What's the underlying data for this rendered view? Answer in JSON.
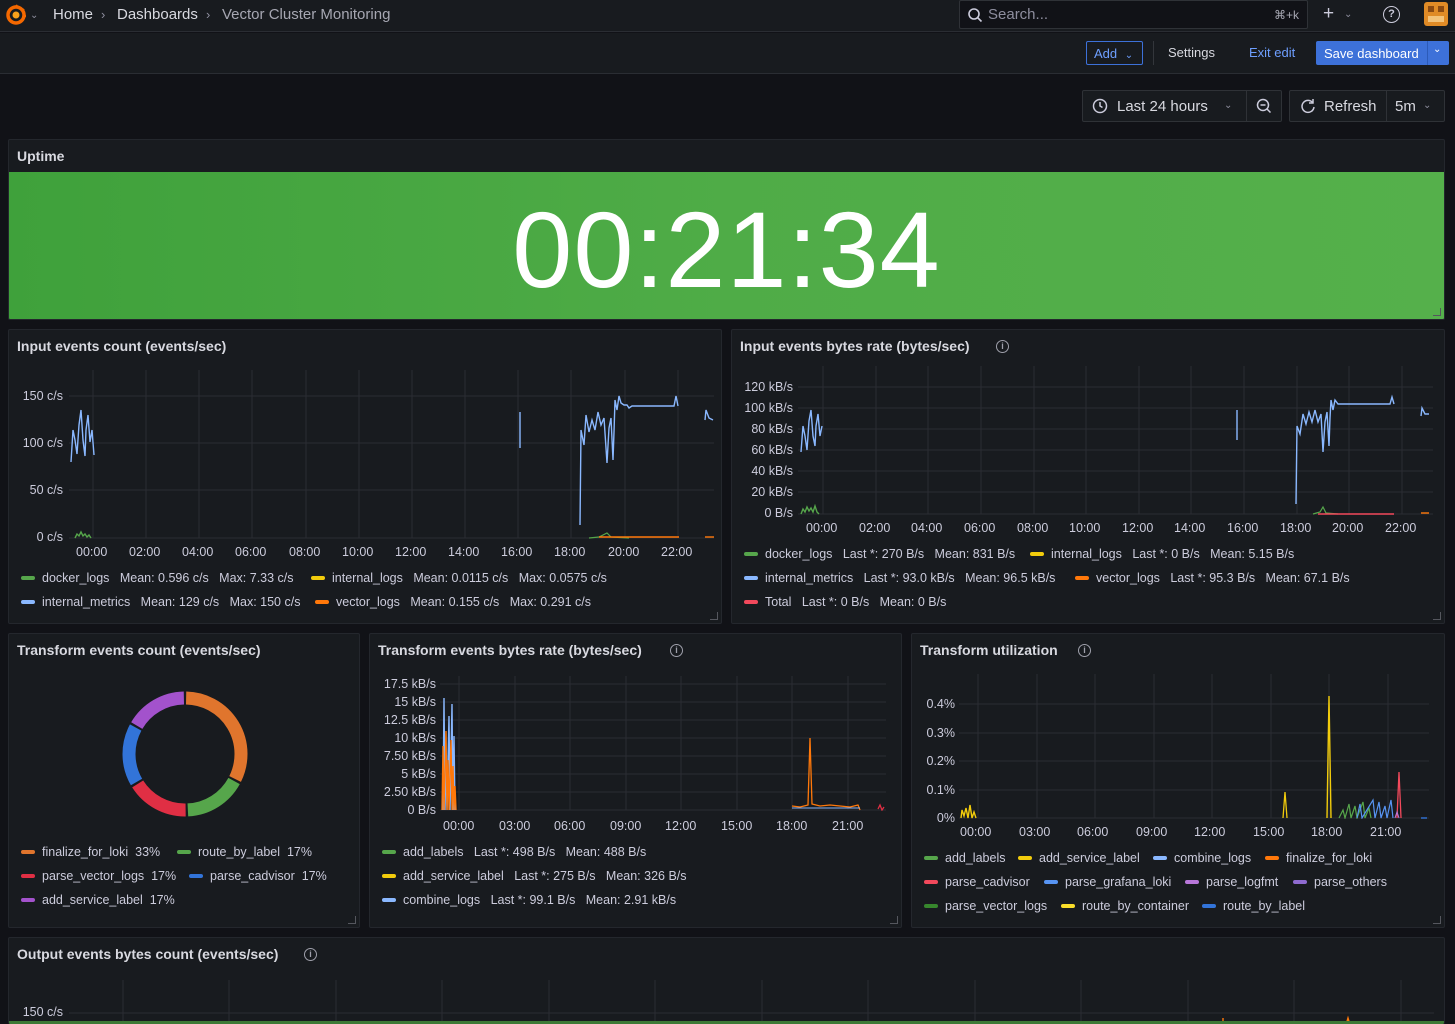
{
  "nav": {
    "breadcrumb": [
      "Home",
      "Dashboards",
      "Vector Cluster Monitoring"
    ],
    "search_placeholder": "Search...",
    "search_shortcut": "⌘+k"
  },
  "toolbar": {
    "add_label": "Add",
    "settings_label": "Settings",
    "exit_edit_label": "Exit edit",
    "save_label": "Save dashboard"
  },
  "time": {
    "range_label": "Last 24 hours",
    "refresh_label": "Refresh",
    "interval": "5m"
  },
  "uptime": {
    "title": "Uptime",
    "value": "00:21:34",
    "color": "#4fac47"
  },
  "input_count": {
    "title": "Input events count (events/sec)",
    "y_ticks": [
      "150 c/s",
      "100 c/s",
      "50 c/s",
      "0 c/s"
    ],
    "x_ticks": [
      "00:00",
      "02:00",
      "04:00",
      "06:00",
      "08:00",
      "10:00",
      "12:00",
      "14:00",
      "16:00",
      "18:00",
      "20:00",
      "22:00"
    ],
    "legend": [
      {
        "name": "docker_logs",
        "stats": "Mean: 0.596 c/s   Max: 7.33 c/s",
        "color": "#56a64b"
      },
      {
        "name": "internal_logs",
        "stats": "Mean: 0.0115 c/s   Max: 0.0575 c/s",
        "color": "#f2cc0c"
      },
      {
        "name": "internal_metrics",
        "stats": "Mean: 129 c/s   Max: 150 c/s",
        "color": "#8ab8ff"
      },
      {
        "name": "vector_logs",
        "stats": "Mean: 0.155 c/s   Max: 0.291 c/s",
        "color": "#ff780a"
      }
    ]
  },
  "input_bytes": {
    "title": "Input events bytes rate (bytes/sec)",
    "y_ticks": [
      "120 kB/s",
      "100 kB/s",
      "80 kB/s",
      "60 kB/s",
      "40 kB/s",
      "20 kB/s",
      "0 B/s"
    ],
    "x_ticks": [
      "00:00",
      "02:00",
      "04:00",
      "06:00",
      "08:00",
      "10:00",
      "12:00",
      "14:00",
      "16:00",
      "18:00",
      "20:00",
      "22:00"
    ],
    "legend": [
      {
        "name": "docker_logs",
        "stats": "Last *: 270 B/s   Mean: 831 B/s",
        "color": "#56a64b"
      },
      {
        "name": "internal_logs",
        "stats": "Last *: 0 B/s   Mean: 5.15 B/s",
        "color": "#f2cc0c"
      },
      {
        "name": "internal_metrics",
        "stats": "Last *: 93.0 kB/s   Mean: 96.5 kB/s",
        "color": "#8ab8ff"
      },
      {
        "name": "vector_logs",
        "stats": "Last *: 95.3 B/s   Mean: 67.1 B/s",
        "color": "#ff780a"
      },
      {
        "name": "Total",
        "stats": "Last *: 0 B/s   Mean: 0 B/s",
        "color": "#f2495c"
      }
    ]
  },
  "transform_count": {
    "title": "Transform events count (events/sec)",
    "slices": [
      {
        "name": "finalize_for_loki",
        "pct": "33%",
        "value": 33,
        "color": "#e0752d"
      },
      {
        "name": "route_by_label",
        "pct": "17%",
        "value": 17,
        "color": "#56a64b"
      },
      {
        "name": "parse_vector_logs",
        "pct": "17%",
        "value": 17,
        "color": "#e02f44"
      },
      {
        "name": "parse_cadvisor",
        "pct": "17%",
        "value": 17,
        "color": "#3274d9"
      },
      {
        "name": "add_service_label",
        "pct": "17%",
        "value": 17,
        "color": "#a352cc"
      }
    ]
  },
  "transform_bytes": {
    "title": "Transform events bytes rate (bytes/sec)",
    "y_ticks": [
      "17.5 kB/s",
      "15 kB/s",
      "12.5 kB/s",
      "10 kB/s",
      "7.50 kB/s",
      "5 kB/s",
      "2.50 kB/s",
      "0 B/s"
    ],
    "x_ticks": [
      "00:00",
      "03:00",
      "06:00",
      "09:00",
      "12:00",
      "15:00",
      "18:00",
      "21:00"
    ],
    "legend": [
      {
        "name": "add_labels",
        "stats": "Last *: 498 B/s   Mean: 488 B/s",
        "color": "#56a64b"
      },
      {
        "name": "add_service_label",
        "stats": "Last *: 275 B/s   Mean: 326 B/s",
        "color": "#f2cc0c"
      },
      {
        "name": "combine_logs",
        "stats": "Last *: 99.1 B/s   Mean: 2.91 kB/s",
        "color": "#8ab8ff"
      }
    ]
  },
  "transform_util": {
    "title": "Transform utilization",
    "y_ticks": [
      "0.4%",
      "0.3%",
      "0.2%",
      "0.1%",
      "0%"
    ],
    "x_ticks": [
      "00:00",
      "03:00",
      "06:00",
      "09:00",
      "12:00",
      "15:00",
      "18:00",
      "21:00"
    ],
    "legend": [
      {
        "name": "add_labels",
        "color": "#56a64b"
      },
      {
        "name": "add_service_label",
        "color": "#f2cc0c"
      },
      {
        "name": "combine_logs",
        "color": "#8ab8ff"
      },
      {
        "name": "finalize_for_loki",
        "color": "#ff780a"
      },
      {
        "name": "parse_cadvisor",
        "color": "#f2495c"
      },
      {
        "name": "parse_grafana_loki",
        "color": "#5794f2"
      },
      {
        "name": "parse_logfmt",
        "color": "#b877d9"
      },
      {
        "name": "parse_others",
        "color": "#8f6bd0"
      },
      {
        "name": "parse_vector_logs",
        "color": "#37872d"
      },
      {
        "name": "route_by_container",
        "color": "#fade2a"
      },
      {
        "name": "route_by_label",
        "color": "#3274d9"
      }
    ]
  },
  "output_bytes": {
    "title": "Output events bytes count (events/sec)",
    "y_ticks": [
      "150 c/s"
    ]
  }
}
